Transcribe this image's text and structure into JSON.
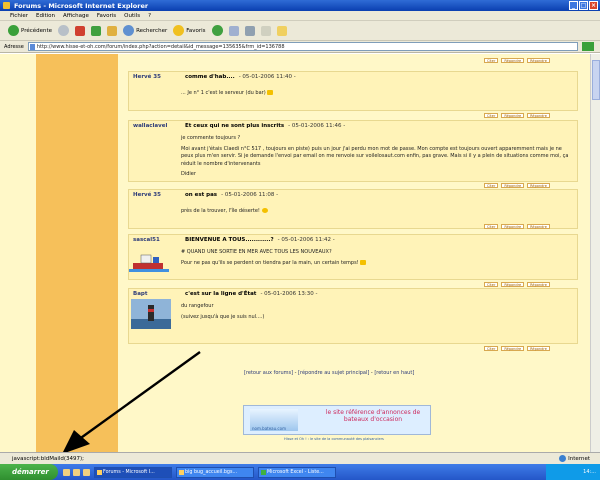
{
  "window": {
    "title": "Forums - Microsoft Internet Explorer"
  },
  "menu": [
    "Fichier",
    "Edition",
    "Affichage",
    "Favoris",
    "Outils",
    "?"
  ],
  "toolbar": {
    "back_label": "Précédente",
    "search_label": "Rechercher",
    "favorites_label": "Favoris"
  },
  "address": {
    "label": "Adresse",
    "url": "http://www.hisse-et-oh.com/forum/index.php?action=detail&id_message=135635&frm_id=136788"
  },
  "posts": [
    {
      "author": "Hervé 35",
      "subject": "comme d'hab....",
      "date": "- 05-01-2006 11:40 -",
      "lines": [
        "... Je n° 1 c'est le serveur (du bar)"
      ]
    },
    {
      "author": "wallaclavel",
      "subject": "Et ceux qui ne sont plus inscrits",
      "date": "- 05-01-2006 11:46 -",
      "lines": [
        "je commente toujours ?",
        "Moi avant j'étais Claedi n°C 517 , toujours en piste) puis un jour j'ai perdu mon mot de passe. Mon compte est toujours ouvert apparemment mais je ne peux plus m'en servir. Si je demande l'envoi par email on me renvoie sur voilelosaut.com enfin, pas grave. Mais si il y a plein de situations comme moi, ça réduit le nombre d'intervenants",
        "Didier"
      ]
    },
    {
      "author": "Hervé 35",
      "subject": "on est pas",
      "date": "- 05-01-2006 11:08 -",
      "lines": [
        "près de la trouver, l'île déserte!"
      ]
    },
    {
      "author": "sascal51",
      "subject": "BIENVENUE A TOUS............?",
      "date": "- 05-01-2006 11:42 -",
      "lines": [
        "# QUAND UNE SORTIE EN MER AVEC TOUS LES NOUVEAUX?",
        "Pour ne pas qu'ils se perdent on tiendra par la main, un certain temps!"
      ]
    },
    {
      "author": "Bapt",
      "subject": "c'est sur la ligne d'État",
      "date": "- 05-01-2006 13:30 -",
      "lines": [
        "du rangefour",
        "(suivez jusqu'à que je suis nul....)"
      ]
    }
  ],
  "post_actions": [
    "Citer",
    "Répondre",
    "Répondre"
  ],
  "footer": {
    "back_forums": "[retour aux forums]",
    "reply_main": "[répondre au sujet principal]",
    "back_top": "[retour en haut]"
  },
  "banner": {
    "tagline": "le site référence d'annonces de bateaux d'occasion",
    "brand": "nom.bateau.com",
    "caption": "Hisse et Oh ! : le site de la communauté des plaisanciers"
  },
  "status": {
    "text": "javascript:bldMaild(3497);",
    "zone": "Internet"
  },
  "taskbar": {
    "start": "démarrer",
    "tasks": [
      "Forums - Microsoft I...",
      "big bug_accueil.bgs...",
      "Microsoft Excel - Liste..."
    ],
    "clock": "14:..."
  }
}
